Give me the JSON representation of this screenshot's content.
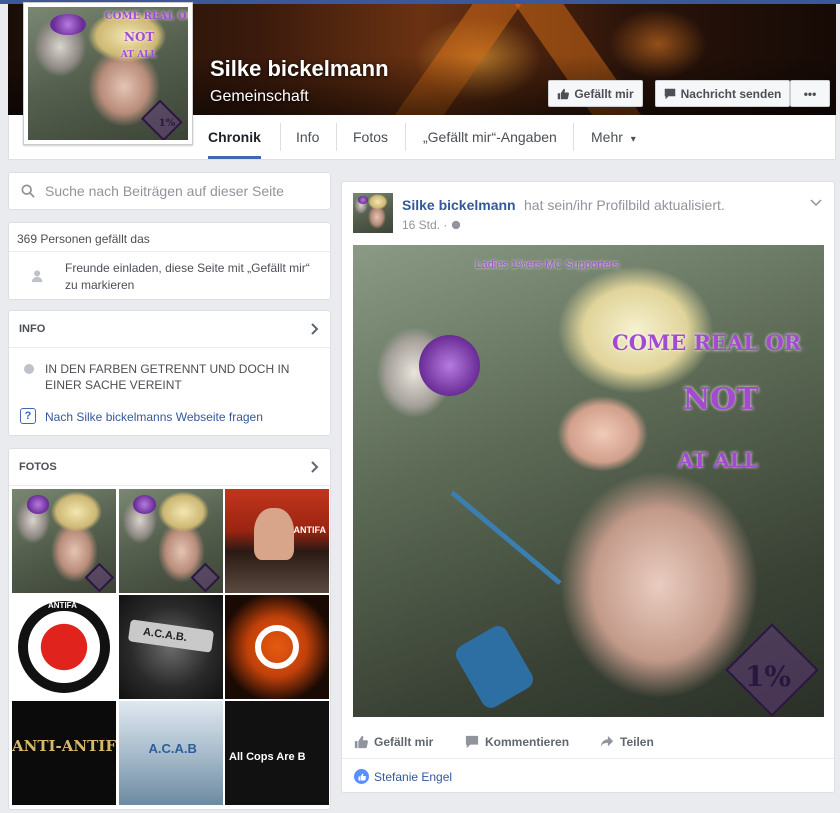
{
  "page": {
    "name": "Silke bickelmann",
    "category": "Gemeinschaft"
  },
  "cover_buttons": {
    "like": "Gefällt mir",
    "message": "Nachricht senden",
    "more": "•••"
  },
  "nav": {
    "tabs": [
      {
        "label": "Chronik"
      },
      {
        "label": "Info"
      },
      {
        "label": "Fotos"
      },
      {
        "label": "„Gefällt mir“-Angaben"
      },
      {
        "label": "Mehr"
      }
    ],
    "more_caret": "▾"
  },
  "sidebar": {
    "search_placeholder": "Suche nach Beiträgen auf dieser Seite",
    "likes_count_text": "369 Personen gefällt das",
    "invite_text": "Freunde einladen, diese Seite mit „Gefällt mir“ zu markieren",
    "info": {
      "title": "INFO",
      "about": "IN DEN FARBEN GETRENNT UND DOCH IN EINER SACHE VEREINT",
      "ask_link": "Nach Silke bickelmanns Webseite fragen"
    },
    "photos": {
      "title": "FOTOS",
      "tiles": [
        {
          "label": "photo-1",
          "caption": ""
        },
        {
          "label": "photo-2",
          "caption": ""
        },
        {
          "label": "photo-3",
          "caption": "ANTIFA"
        },
        {
          "label": "photo-4",
          "caption": "ANTIFA"
        },
        {
          "label": "photo-5",
          "caption": "A.C.A.B."
        },
        {
          "label": "photo-6",
          "caption": ""
        },
        {
          "label": "photo-7",
          "caption": "ANTI-ANTIF"
        },
        {
          "label": "photo-8",
          "caption": "A.C.A.B"
        },
        {
          "label": "photo-9",
          "caption": "All Cops Are B"
        }
      ]
    }
  },
  "post": {
    "author": "Silke bickelmann",
    "action": "hat sein/ihr Profilbild aktualisiert.",
    "time": "16 Std.",
    "time_separator": "·",
    "image_texts": {
      "top": "Ladies 1%ers MC Supporters",
      "line1": "COME REAL OR",
      "line2": "NOT",
      "line3": "AT ALL",
      "emblem": "1%"
    },
    "actions": {
      "like": "Gefällt mir",
      "comment": "Kommentieren",
      "share": "Teilen"
    },
    "reaction_name": "Stefanie Engel"
  },
  "profile_pic_texts": {
    "line1": "COME REAL OR",
    "line2": "NOT",
    "line3": "AT ALL",
    "emblem": "1%"
  },
  "colors": {
    "brand_blue": "#3b5998",
    "link_blue": "#365899",
    "accent_purple": "#a44ad1"
  }
}
